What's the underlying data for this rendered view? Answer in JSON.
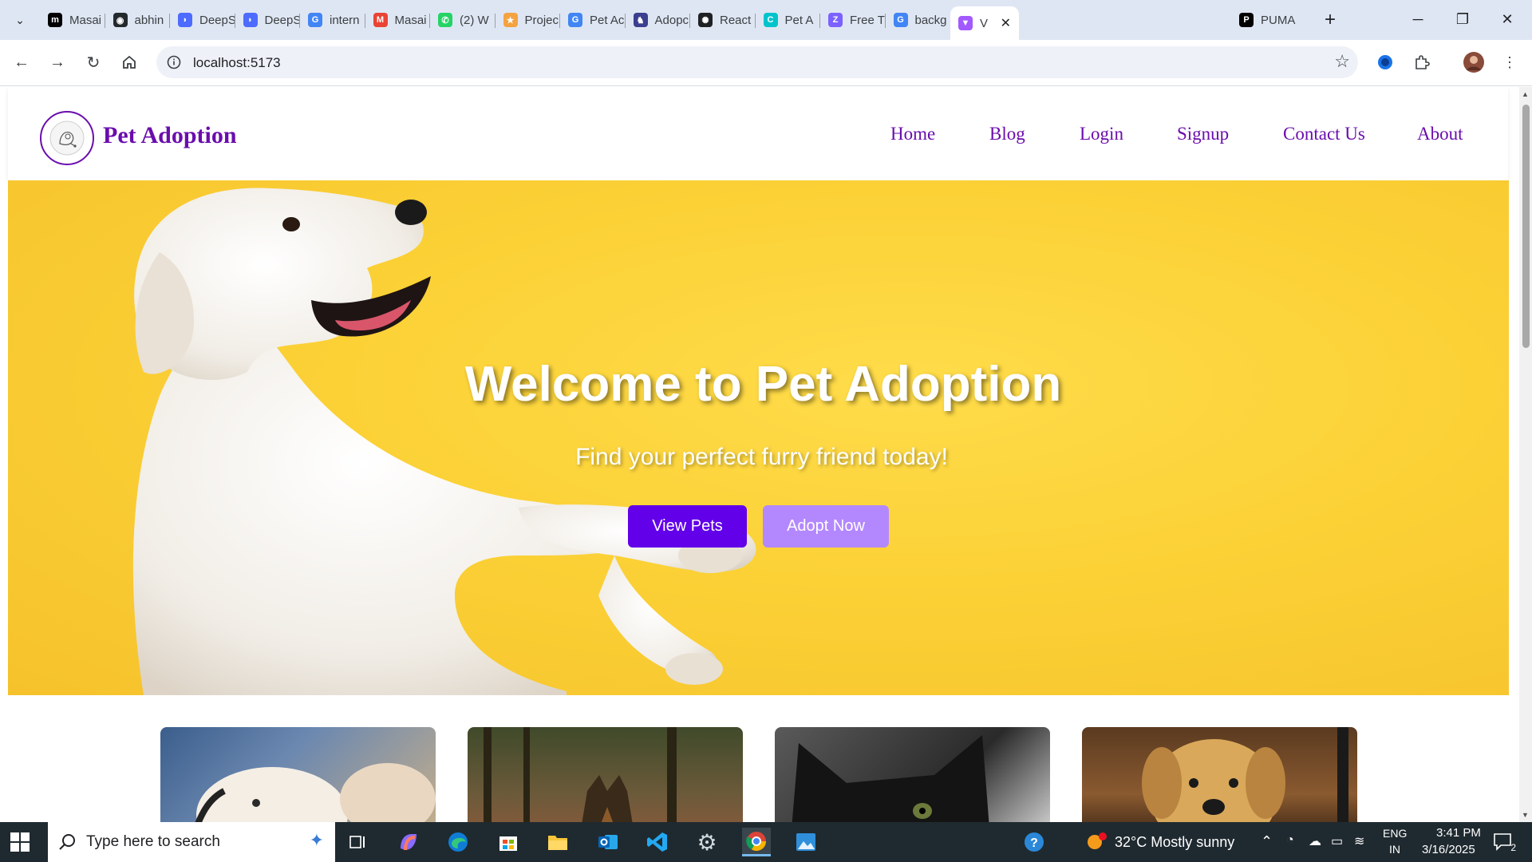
{
  "browser": {
    "tabs": [
      {
        "title": "Masai",
        "favicon": "masai-icon",
        "color": "#000000",
        "glyph": "m"
      },
      {
        "title": "abhin",
        "favicon": "github-icon",
        "color": "#24292e",
        "glyph": "◉"
      },
      {
        "title": "DeepS",
        "favicon": "deepseek-icon",
        "color": "#4d6bfe",
        "glyph": "◗"
      },
      {
        "title": "DeepS",
        "favicon": "deepseek-icon",
        "color": "#4d6bfe",
        "glyph": "◗"
      },
      {
        "title": "intern",
        "favicon": "google-icon",
        "color": "#4285f4",
        "glyph": "G"
      },
      {
        "title": "Masai",
        "favicon": "gmail-icon",
        "color": "#ea4335",
        "glyph": "M"
      },
      {
        "title": "(2) W",
        "favicon": "whatsapp-icon",
        "color": "#25d366",
        "glyph": "✆"
      },
      {
        "title": "Projec",
        "favicon": "star-icon",
        "color": "#f4a340",
        "glyph": "★"
      },
      {
        "title": "Pet Ac",
        "favicon": "google-icon",
        "color": "#4285f4",
        "glyph": "G"
      },
      {
        "title": "Adopc",
        "favicon": "dog-icon",
        "color": "#3b3f8f",
        "glyph": "♞"
      },
      {
        "title": "React",
        "favicon": "openai-icon",
        "color": "#202124",
        "glyph": "✺"
      },
      {
        "title": "Pet A",
        "favicon": "canva-icon",
        "color": "#00c4cc",
        "glyph": "C"
      },
      {
        "title": "Free T",
        "favicon": "zfree-icon",
        "color": "#7b61ff",
        "glyph": "Z"
      },
      {
        "title": "backg",
        "favicon": "google-icon",
        "color": "#4285f4",
        "glyph": "G"
      },
      {
        "title": "V",
        "favicon": "vite-icon",
        "color": "#a259ff",
        "glyph": "▼"
      },
      {
        "title": "PUMA",
        "favicon": "puma-icon",
        "color": "#000000",
        "glyph": "P"
      }
    ],
    "url": "localhost:5173"
  },
  "site": {
    "brand": "Pet Adoption",
    "nav": [
      "Home",
      "Blog",
      "Login",
      "Signup",
      "Contact Us",
      "About"
    ],
    "hero": {
      "title": "Welcome to Pet Adoption",
      "subtitle": "Find your perfect furry friend today!",
      "primary_button": "View Pets",
      "secondary_button": "Adopt Now"
    },
    "colors": {
      "brand": "#6a0dad",
      "primary": "#6200ea",
      "secondary": "#b388ff",
      "hero_bg": "#fbd136"
    },
    "pet_cards": [
      {
        "name": "white-puppy-card"
      },
      {
        "name": "german-shepherd-card"
      },
      {
        "name": "black-cat-card"
      },
      {
        "name": "golden-puppy-card"
      }
    ]
  },
  "taskbar": {
    "search_placeholder": "Type here to search",
    "weather": "32°C  Mostly sunny",
    "lang_top": "ENG",
    "lang_bottom": "IN",
    "time": "3:41 PM",
    "date": "3/16/2025",
    "notification_count": "2"
  }
}
